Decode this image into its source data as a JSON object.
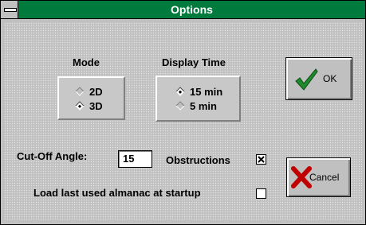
{
  "window": {
    "title": "Options"
  },
  "mode": {
    "label": "Mode",
    "options": [
      {
        "label": "2D",
        "selected": false
      },
      {
        "label": "3D",
        "selected": true
      }
    ]
  },
  "display_time": {
    "label": "Display Time",
    "options": [
      {
        "label": "15 min",
        "selected": true
      },
      {
        "label": "5 min",
        "selected": false
      }
    ]
  },
  "buttons": {
    "ok_label": "OK",
    "cancel_label": "Cancel"
  },
  "cutoff": {
    "label": "Cut-Off Angle:",
    "value": "15"
  },
  "obstructions": {
    "label": "Obstructions",
    "checked": true
  },
  "load_last": {
    "label": "Load last used almanac at startup",
    "checked": false
  },
  "colors": {
    "title_bar": "#007a3d",
    "ok_check": "#1f8a2c",
    "cancel_x": "#c00000"
  }
}
